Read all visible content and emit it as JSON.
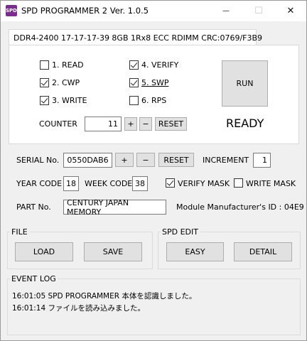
{
  "window": {
    "icon_text": "SPD",
    "title": "SPD PROGRAMMER 2 Ver. 1.0.5",
    "minimize": "—",
    "maximize": "☐",
    "close": "✕"
  },
  "module": {
    "tab_label": "DDR4-2400 17-17-17-39 8GB 1Rx8 ECC RDIMM CRC:0769/F3B9"
  },
  "options": [
    {
      "label": "1. READ",
      "checked": false
    },
    {
      "label": "2. CWP",
      "checked": true
    },
    {
      "label": "3. WRITE",
      "checked": true
    },
    {
      "label": "4. VERIFY",
      "checked": true
    },
    {
      "label": "5. SWP",
      "checked": true
    },
    {
      "label": "6. RPS",
      "checked": false
    }
  ],
  "run_button": "RUN",
  "status": "READY",
  "counter": {
    "label": "COUNTER",
    "value": "11",
    "plus": "+",
    "minus": "−",
    "reset": "RESET"
  },
  "serial": {
    "label": "SERIAL No.",
    "value": "0550DAB6",
    "plus": "+",
    "minus": "−",
    "reset": "RESET",
    "increment_label": "INCREMENT",
    "increment_value": "1"
  },
  "codes": {
    "year_label": "YEAR CODE",
    "year_value": "18",
    "week_label": "WEEK CODE",
    "week_value": "38",
    "verify_mask_label": "VERIFY MASK",
    "verify_mask_checked": true,
    "write_mask_label": "WRITE MASK",
    "write_mask_checked": false
  },
  "part": {
    "label": "PART No.",
    "value": "CENTURY JAPAN MEMORY",
    "manufacturer_label": "Module Manufacturer's ID : 04E9"
  },
  "file": {
    "title": "FILE",
    "load": "LOAD",
    "save": "SAVE"
  },
  "spd_edit": {
    "title": "SPD EDIT",
    "easy": "EASY",
    "detail": "DETAIL"
  },
  "event_log": {
    "title": "EVENT LOG",
    "lines": [
      "16:01:05 SPD PROGRAMMER 本体を認識しました。",
      "16:01:14 ファイルを読み込みました。"
    ]
  }
}
